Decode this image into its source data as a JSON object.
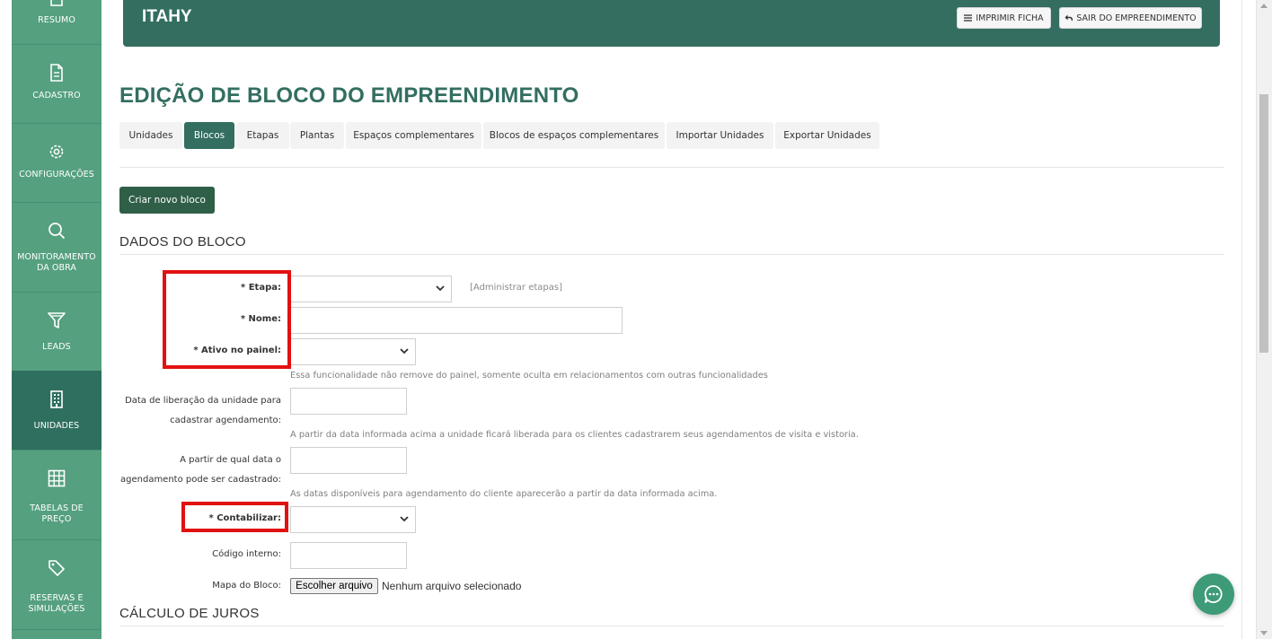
{
  "sidebar": {
    "items": [
      {
        "label": "RESUMO",
        "icon": "home-icon"
      },
      {
        "label": "CADASTRO",
        "icon": "document-icon"
      },
      {
        "label": "CONFIGURAÇÕES",
        "icon": "gear-icon"
      },
      {
        "label": "MONITORAMENTO DA OBRA",
        "icon": "search-icon"
      },
      {
        "label": "LEADS",
        "icon": "funnel-icon"
      },
      {
        "label": "UNIDADES",
        "icon": "building-icon"
      },
      {
        "label": "TABELAS DE PREÇO",
        "icon": "table-icon"
      },
      {
        "label": "RESERVAS E SIMULAÇÕES",
        "icon": "tag-icon"
      }
    ],
    "active": "UNIDADES"
  },
  "header": {
    "title": "ITAHY",
    "print_label": "IMPRIMIR FICHA",
    "exit_label": "SAIR DO EMPREENDIMENTO"
  },
  "page": {
    "title": "EDIÇÃO DE BLOCO DO EMPREENDIMENTO",
    "tabs": [
      "Unidades",
      "Blocos",
      "Etapas",
      "Plantas",
      "Espaços complementares",
      "Blocos de espaços complementares",
      "Importar Unidades",
      "Exportar Unidades"
    ],
    "active_tab": "Blocos",
    "new_block_label": "Criar novo bloco"
  },
  "form": {
    "section_title": "DADOS DO BLOCO",
    "etapa_label": "* Etapa:",
    "etapa_value": "",
    "admin_link": "[Administrar etapas]",
    "nome_label": "* Nome:",
    "nome_value": "",
    "ativo_label": "* Ativo no painel:",
    "ativo_value": "",
    "ativo_help": "Essa funcionalidade não remove do painel, somente oculta em relacionamentos com outras funcionalidades",
    "liberacao_label": "Data de liberação da unidade para cadastrar agendamento:",
    "liberacao_value": "",
    "liberacao_help": "A partir da data informada acima a unidade ficará liberada para os clientes cadastrarem seus agendamentos de visita e vistoria.",
    "partir_label": "A partir de qual data o agendamento pode ser cadastrado:",
    "partir_value": "",
    "partir_help": "As datas disponíveis para agendamento do cliente aparecerão a partir da data informada acima.",
    "contabilizar_label": "* Contabilizar:",
    "contabilizar_value": "",
    "codigo_label": "Código interno:",
    "codigo_value": "",
    "mapa_label": "Mapa do Bloco:",
    "file_button": "Escolher arquivo",
    "file_status": "Nenhum arquivo selecionado"
  },
  "juros": {
    "section_title": "CÁLCULO DE JUROS"
  },
  "colors": {
    "sidebar": "#55a07f",
    "sidebar_active": "#2f6f5f",
    "header": "#336e61",
    "primary_button": "#2f5f47",
    "highlight": "#e21111",
    "chat": "#3d9b78"
  }
}
